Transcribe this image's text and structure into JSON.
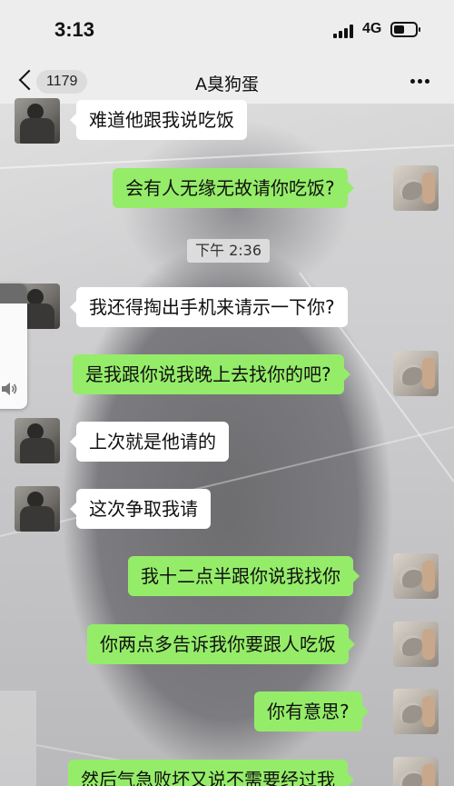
{
  "status_bar": {
    "time": "3:13",
    "network": "4G"
  },
  "nav": {
    "unread_count": "1179",
    "title": "A臭狗蛋"
  },
  "timestamp": "下午 2:36",
  "messages": [
    {
      "side": "left",
      "text": "难道他跟我说吃饭"
    },
    {
      "side": "right",
      "text": "会有人无缘无故请你吃饭?"
    },
    {
      "side": "left",
      "text": "我还得掏出手机来请示一下你?"
    },
    {
      "side": "right",
      "text": "是我跟你说我晚上去找你的吧?"
    },
    {
      "side": "left",
      "text": "上次就是他请的"
    },
    {
      "side": "left",
      "text": "这次争取我请"
    },
    {
      "side": "right",
      "text": "我十二点半跟你说我找你"
    },
    {
      "side": "right",
      "text": "你两点多告诉我你要跟人吃饭"
    },
    {
      "side": "right",
      "text": "你有意思?"
    },
    {
      "side": "right",
      "text": "然后气急败坏又说不需要经过我"
    }
  ],
  "colors": {
    "right_bubble": "#95ec69",
    "left_bubble": "#ffffff",
    "bar_bg": "#ededed"
  },
  "icons": [
    "back-chevron-icon",
    "more-dots-icon",
    "signal-icon",
    "battery-icon",
    "speaker-icon"
  ]
}
